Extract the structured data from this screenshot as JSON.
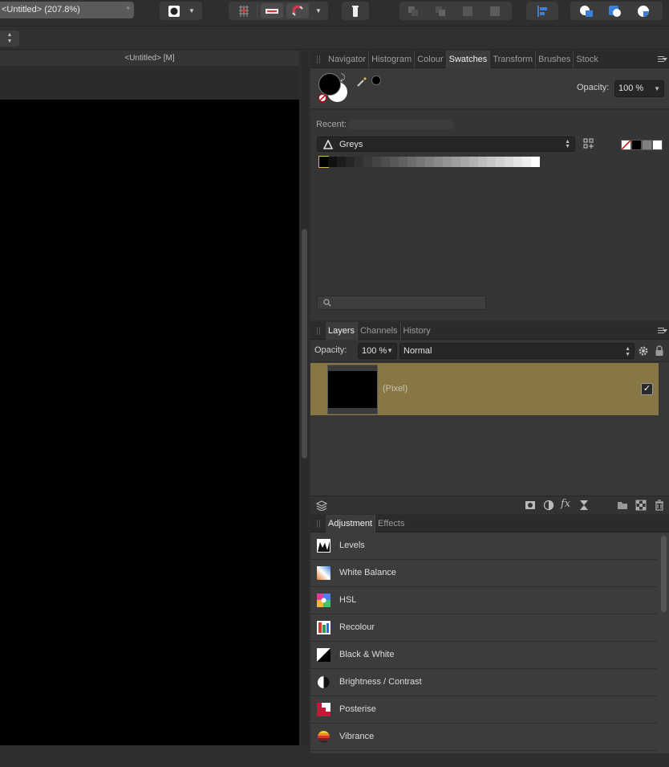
{
  "document": {
    "title": "<Untitled> (207.8%)",
    "modified_mark": "*",
    "view_title": "<Untitled> [M]"
  },
  "swatches_panel": {
    "tabs": [
      "Navigator",
      "Histogram",
      "Colour",
      "Swatches",
      "Transform",
      "Brushes",
      "Stock"
    ],
    "active_tab": "Swatches",
    "opacity_label": "Opacity:",
    "opacity_value": "100 %",
    "recent_label": "Recent:",
    "palette_name": "Greys",
    "fill_color": "#000000",
    "stroke_color": "#ffffff",
    "quick_swatch_colors": [
      "none",
      "#000000",
      "#808080",
      "#ffffff"
    ],
    "grey_swatches": [
      "#000000",
      "#111111",
      "#1c1c1c",
      "#262626",
      "#303030",
      "#3a3a3a",
      "#444444",
      "#4e4e4e",
      "#585858",
      "#626262",
      "#6c6c6c",
      "#767676",
      "#808080",
      "#8a8a8a",
      "#949494",
      "#9e9e9e",
      "#a8a8a8",
      "#b2b2b2",
      "#bcbcbc",
      "#c6c6c6",
      "#d0d0d0",
      "#dadada",
      "#e4e4e4",
      "#eeeeee",
      "#ffffff"
    ],
    "search_placeholder": ""
  },
  "layers_panel": {
    "tabs": [
      "Layers",
      "Channels",
      "History"
    ],
    "active_tab": "Layers",
    "opacity_label": "Opacity:",
    "opacity_value": "100 %",
    "blend_mode": "Normal",
    "layers": [
      {
        "name": "(Pixel)",
        "visible": true
      }
    ],
    "layer_highlight_color": "#877744"
  },
  "adjustment_panel": {
    "tabs": [
      "Adjustment",
      "Effects"
    ],
    "active_tab": "Adjustment",
    "items": [
      {
        "label": "Levels",
        "icon": "levels-icon"
      },
      {
        "label": "White Balance",
        "icon": "white-balance-icon"
      },
      {
        "label": "HSL",
        "icon": "hsl-icon"
      },
      {
        "label": "Recolour",
        "icon": "recolour-icon"
      },
      {
        "label": "Black & White",
        "icon": "black-white-icon"
      },
      {
        "label": "Brightness / Contrast",
        "icon": "brightness-contrast-icon"
      },
      {
        "label": "Posterise",
        "icon": "posterise-icon"
      },
      {
        "label": "Vibrance",
        "icon": "vibrance-icon"
      }
    ]
  }
}
